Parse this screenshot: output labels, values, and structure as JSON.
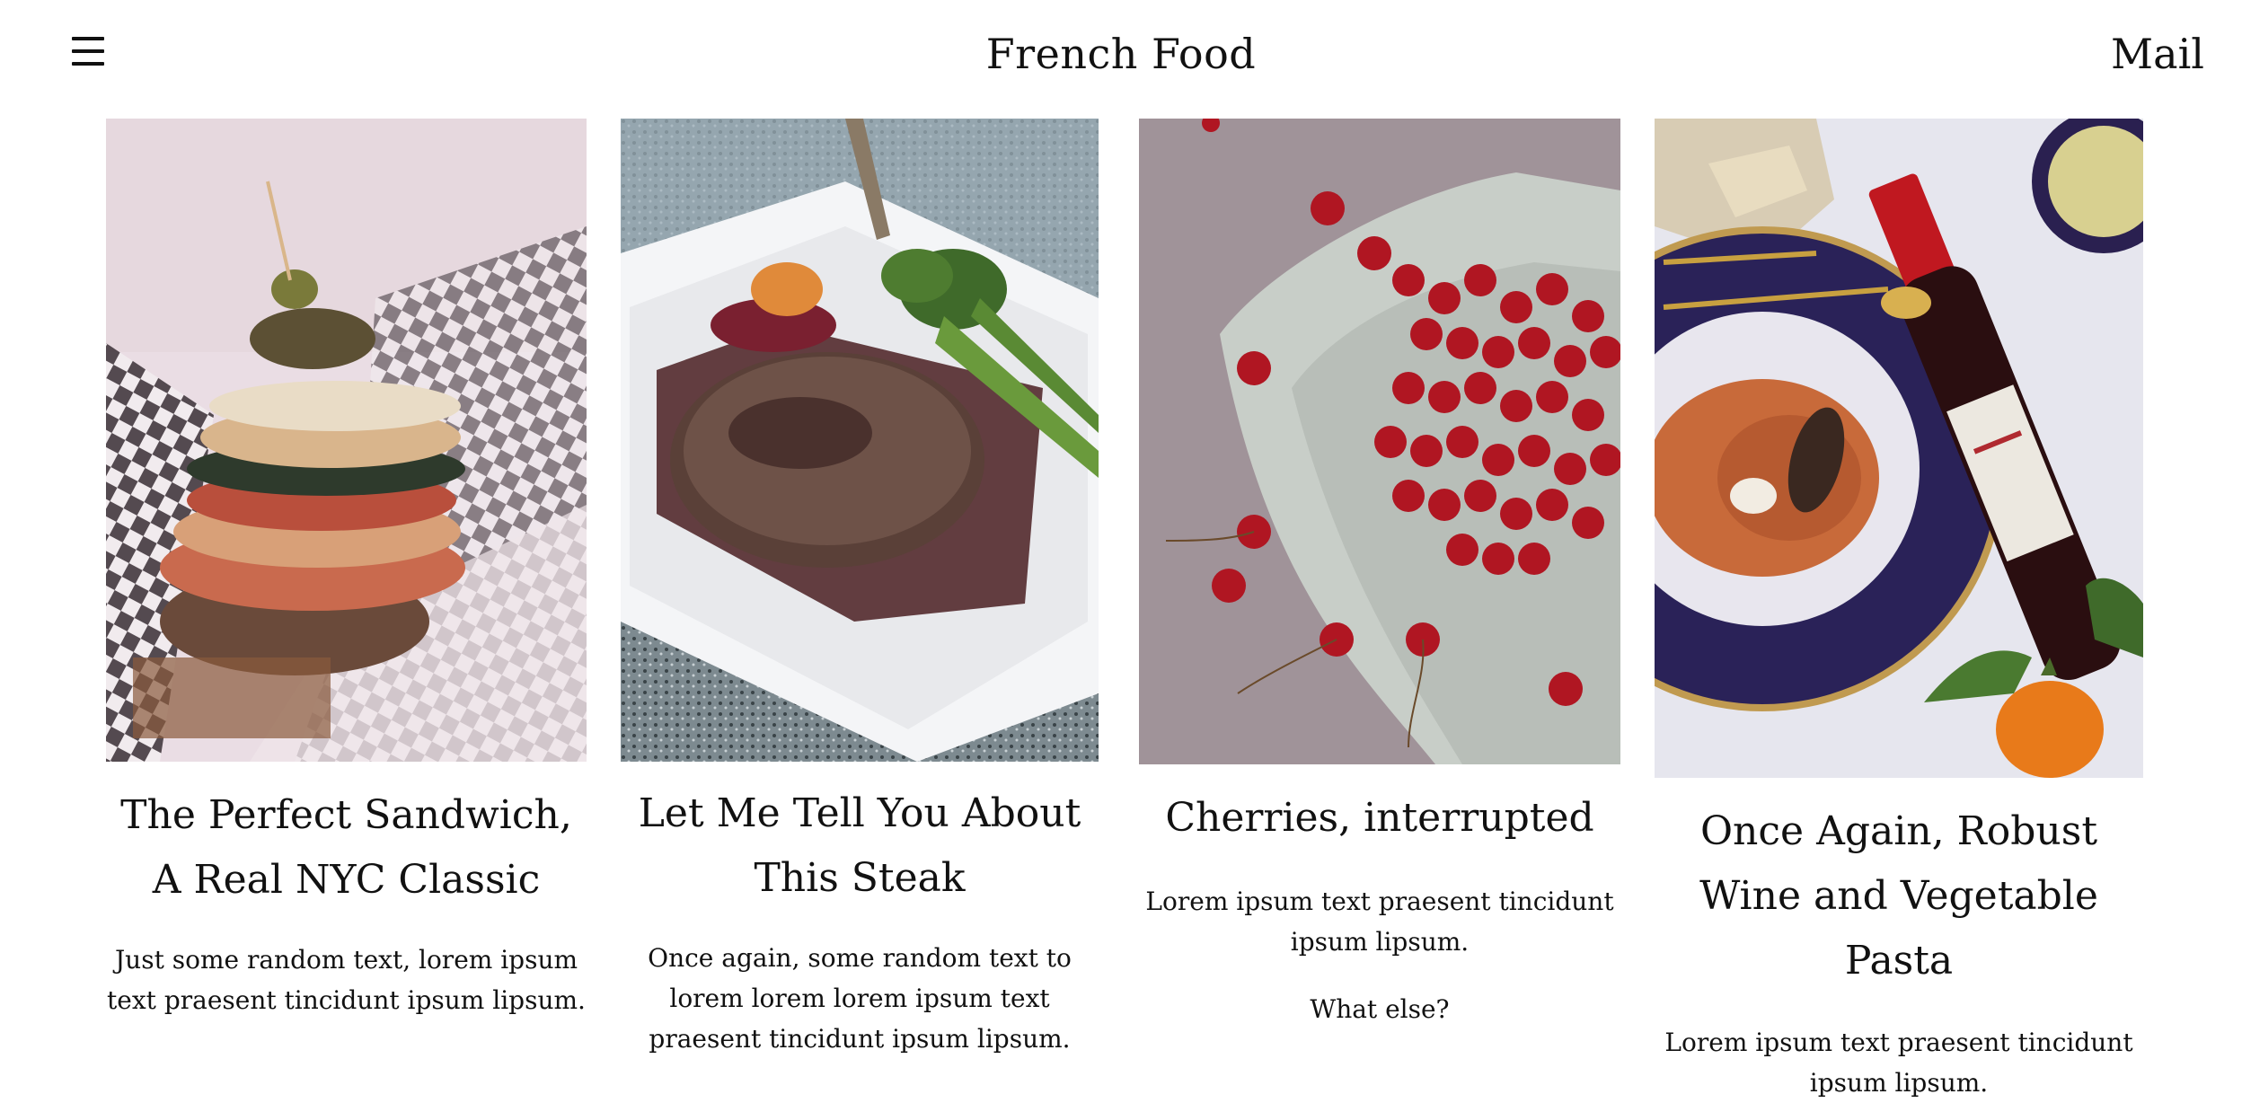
{
  "header": {
    "menu_icon": "hamburger-menu-icon",
    "title": "French Food",
    "mail_label": "Mail"
  },
  "cards": [
    {
      "image": "sandwich-photo",
      "title": "The Perfect Sandwich, A Real NYC Classic",
      "excerpt": [
        "Just some random text, lorem ipsum text praesent tincidunt ipsum lipsum."
      ]
    },
    {
      "image": "steak-photo",
      "title": "Let Me Tell You About This Steak",
      "excerpt": [
        "Once again, some random text to lorem lorem lorem ipsum text praesent tincidunt ipsum lipsum."
      ]
    },
    {
      "image": "cherries-photo",
      "title": "Cherries, interrupted",
      "excerpt": [
        "Lorem ipsum text praesent tincidunt ipsum lipsum.",
        "What else?"
      ]
    },
    {
      "image": "wine-pasta-photo",
      "title": "Once Again, Robust Wine and Vegetable Pasta",
      "excerpt": [
        "Lorem ipsum text praesent tincidunt ipsum lipsum."
      ]
    }
  ]
}
